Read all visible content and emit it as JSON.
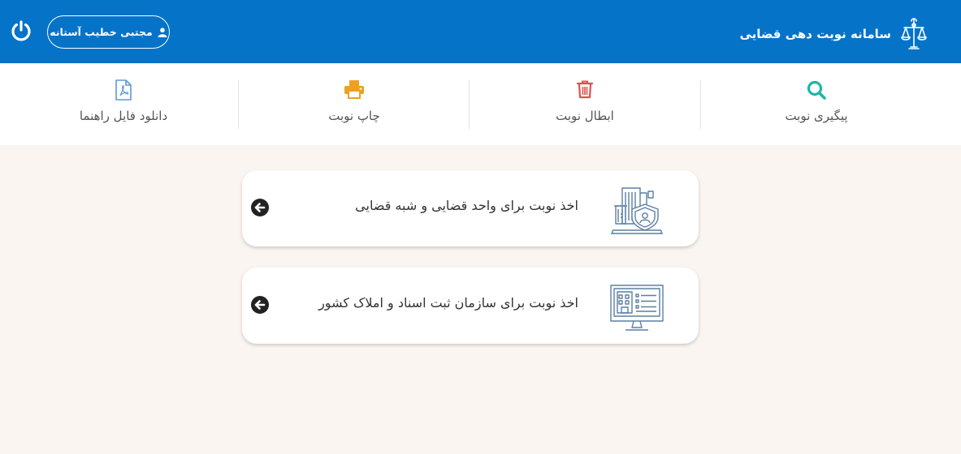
{
  "header": {
    "title": "سامانه نوبت دهی قضایی",
    "logo_icon": "scales-of-justice-icon",
    "user_name": "مجتبی خطیب آستانه",
    "user_icon": "user-icon",
    "power_icon": "power-icon",
    "background_color": "#0573c8"
  },
  "nav": {
    "items": [
      {
        "label": "پیگیری نوبت",
        "icon": "search-icon",
        "color": "#1fb5a6"
      },
      {
        "label": "ابطال نوبت",
        "icon": "trash-icon",
        "color": "#d9534f"
      },
      {
        "label": "چاپ نوبت",
        "icon": "print-icon",
        "color": "#f0a020"
      },
      {
        "label": "دانلود فایل راهنما",
        "icon": "pdf-file-icon",
        "color": "#5b9bd5"
      }
    ]
  },
  "cards": [
    {
      "label": "اخذ نوبت برای واحد قضایی و شبه قضایی",
      "icon": "court-building-icon",
      "arrow_icon": "arrow-left-circle-icon"
    },
    {
      "label": "اخذ نوبت برای سازمان ثبت اسناد و املاک کشور",
      "icon": "monitor-registry-icon",
      "arrow_icon": "arrow-left-circle-icon"
    }
  ]
}
